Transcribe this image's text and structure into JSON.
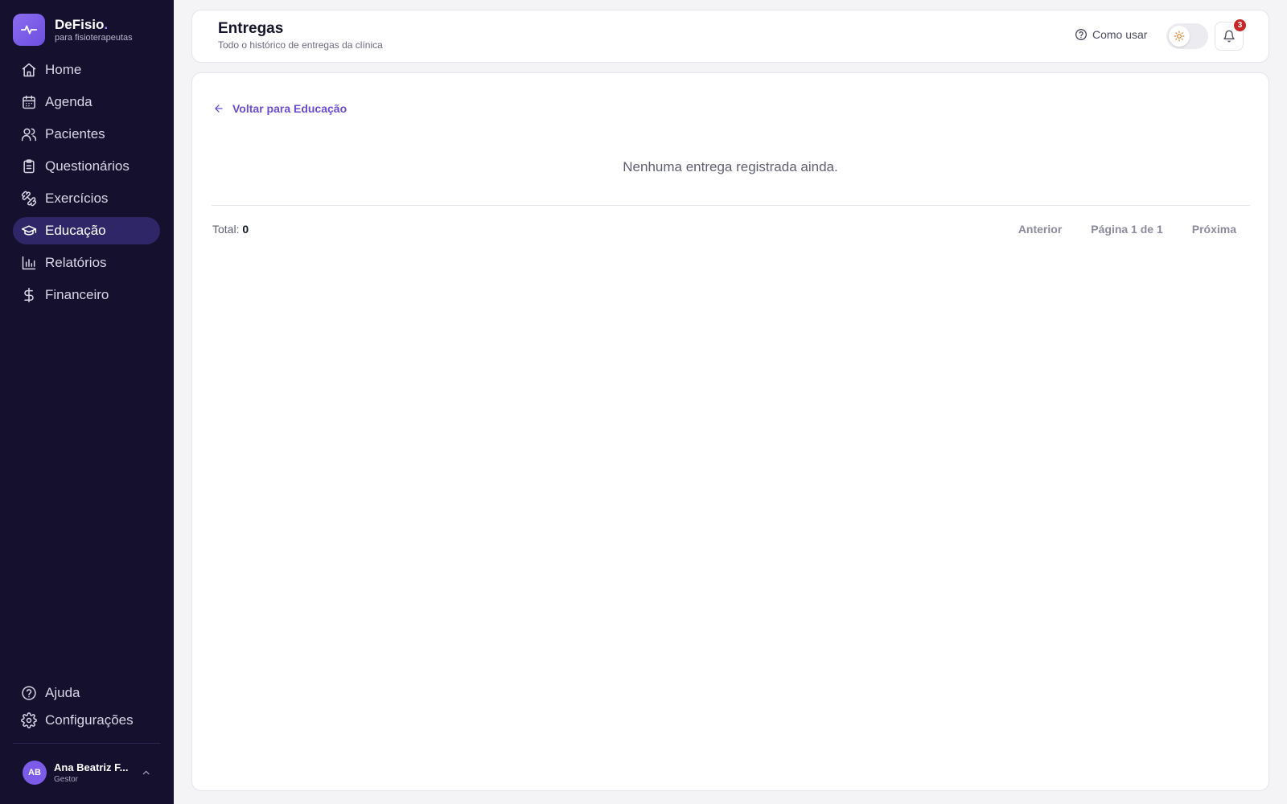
{
  "brand": {
    "name": "DeFisio",
    "dot": ".",
    "subtitle": "para fisioterapeutas"
  },
  "sidebar": {
    "items": [
      {
        "label": "Home",
        "icon": "home-icon",
        "active": false
      },
      {
        "label": "Agenda",
        "icon": "calendar-icon",
        "active": false
      },
      {
        "label": "Pacientes",
        "icon": "users-icon",
        "active": false
      },
      {
        "label": "Questionários",
        "icon": "clipboard-icon",
        "active": false
      },
      {
        "label": "Exercícios",
        "icon": "dumbbell-icon",
        "active": false
      },
      {
        "label": "Educação",
        "icon": "graduation-cap-icon",
        "active": true
      },
      {
        "label": "Relatórios",
        "icon": "bar-chart-icon",
        "active": false
      },
      {
        "label": "Financeiro",
        "icon": "dollar-icon",
        "active": false
      }
    ],
    "bottom_items": [
      {
        "label": "Ajuda",
        "icon": "help-circle-icon"
      },
      {
        "label": "Configurações",
        "icon": "gear-icon"
      }
    ],
    "user": {
      "initials": "AB",
      "name": "Ana Beatriz F...",
      "role": "Gestor"
    }
  },
  "header": {
    "title": "Entregas",
    "subtitle": "Todo o histórico de entregas da clínica",
    "help_label": "Como usar",
    "notification_count": "3"
  },
  "main": {
    "back_label": "Voltar para Educação",
    "empty_message": "Nenhuma entrega registrada ainda.",
    "total_label": "Total:",
    "total_value": "0",
    "pagination": {
      "previous": "Anterior",
      "page_info": "Página 1 de 1",
      "next": "Próxima"
    }
  },
  "colors": {
    "sidebar_bg": "#14102e",
    "accent": "#6a4bd6",
    "active_bg": "#2f2668",
    "badge": "#c62828"
  }
}
